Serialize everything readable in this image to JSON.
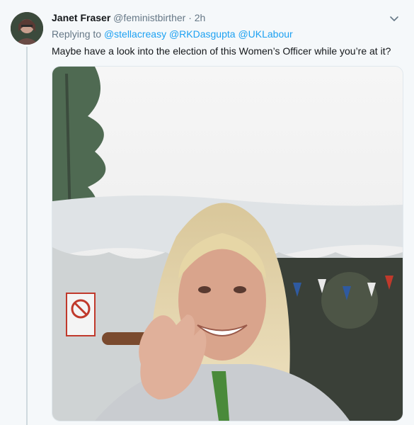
{
  "author": {
    "name": "Janet Fraser",
    "handle": "@feministbirther",
    "separator": "·",
    "time": "2h"
  },
  "reply": {
    "prefix": "Replying to",
    "mentions": [
      "@stellacreasy",
      "@RKDasgupta",
      "@UKLabour"
    ]
  },
  "tweet_text": "Maybe have a look into the election of this Women’s Officer while you’re at it?",
  "icons": {
    "more": "chevron-down-icon"
  },
  "colors": {
    "link": "#1da1f2",
    "muted": "#657786",
    "background": "#f5f8fa"
  }
}
